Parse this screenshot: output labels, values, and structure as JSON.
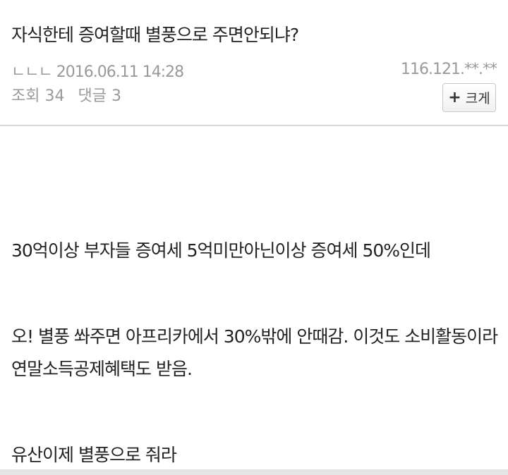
{
  "post": {
    "title": "자식한테 증여할때 별풍으로 주면안되냐?",
    "author": "ㄴㄴㄴ",
    "datetime": "2016.06.11 14:28",
    "ip": "116.121.**.**",
    "views_label": "조회",
    "views": "34",
    "comments_label": "댓글",
    "comments": "3",
    "enlarge_label": "크게",
    "enlarge_icon": "+"
  },
  "content": {
    "lines": [
      "30억이상 부자들 증여세 5억미만아닌이상 증여세 50%인데",
      "오! 별풍 쏴주면 아프리카에서 30%밖에 안때감. 이것도 소비활동이라",
      "연말소득공제혜택도 받음.",
      "유산이제 별풍으로 줘라"
    ]
  }
}
